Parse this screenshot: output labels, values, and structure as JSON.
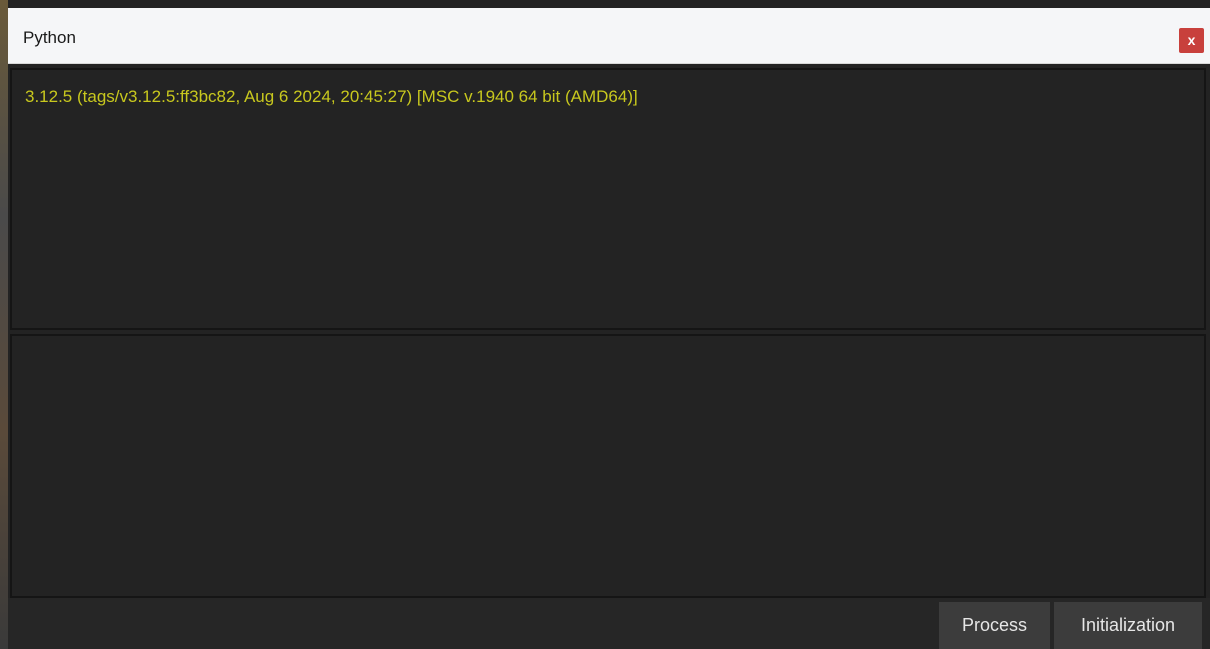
{
  "window": {
    "title": "Python",
    "close_label": "x"
  },
  "output": {
    "text": "3.12.5 (tags/v3.12.5:ff3bc82, Aug 6 2024, 20:45:27) [MSC v.1940 64 bit (AMD64)]"
  },
  "input": {
    "value": ""
  },
  "buttons": {
    "process": "Process",
    "initialization": "Initialization"
  },
  "colors": {
    "output_text": "#c8c81e",
    "pane_background": "#232323",
    "close_button": "#c8403c"
  }
}
